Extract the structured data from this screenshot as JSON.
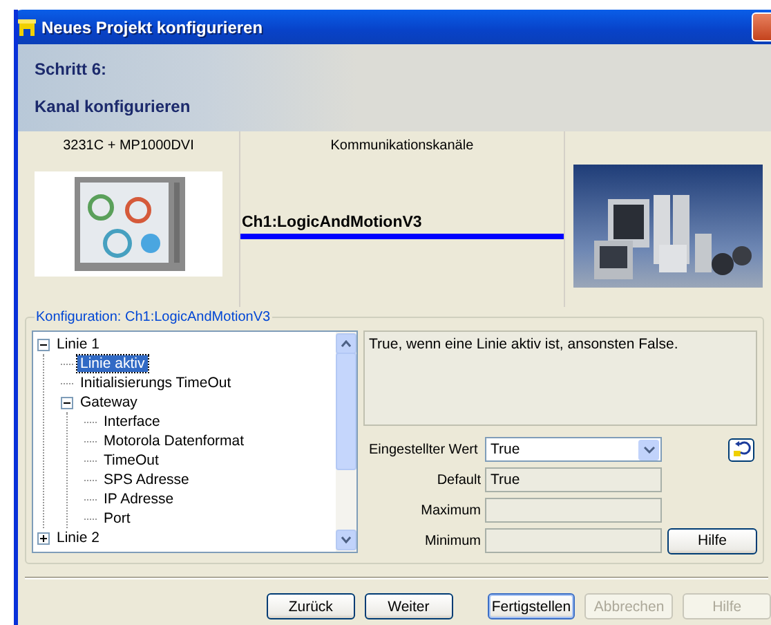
{
  "window": {
    "title": "Neues Projekt konfigurieren"
  },
  "header": {
    "step": "Schritt 6:",
    "subtitle": "Kanal konfigurieren"
  },
  "devices": {
    "device_label": "3231C + MP1000DVI",
    "channels_label": "Kommunikationskanäle",
    "channel": "Ch1:LogicAndMotionV3"
  },
  "config": {
    "legend": "Konfiguration: Ch1:LogicAndMotionV3",
    "tree": [
      {
        "label": "Linie 1",
        "expanded": true,
        "selected": false,
        "children": [
          {
            "label": "Linie aktiv",
            "selected": true
          },
          {
            "label": "Initialisierungs TimeOut",
            "selected": false
          },
          {
            "label": "Gateway",
            "expanded": true,
            "selected": false,
            "children": [
              {
                "label": "Interface",
                "selected": false
              },
              {
                "label": "Motorola Datenformat",
                "selected": false
              },
              {
                "label": "TimeOut",
                "selected": false
              },
              {
                "label": "SPS Adresse",
                "selected": false
              },
              {
                "label": "IP Adresse",
                "selected": false
              },
              {
                "label": "Port",
                "selected": false
              }
            ]
          }
        ]
      },
      {
        "label": "Linie 2",
        "expanded": false,
        "selected": false
      }
    ],
    "description": "True, wenn eine Linie aktiv ist, ansonsten False.",
    "fields": [
      {
        "kind": "combo",
        "label": "Eingestellter Wert",
        "value": "True"
      },
      {
        "kind": "readonly",
        "label": "Default",
        "value": "True"
      },
      {
        "kind": "readonly",
        "label": "Maximum"
      },
      {
        "kind": "readonly",
        "label": "Minimum"
      }
    ],
    "help_button": "Hilfe"
  },
  "buttons": [
    {
      "label": "Zurück",
      "disabled": false,
      "default": false
    },
    {
      "label": "Weiter",
      "disabled": false,
      "default": false
    },
    {
      "label": "Fertigstellen",
      "disabled": false,
      "default": true
    },
    {
      "label": "Abbrechen",
      "disabled": true,
      "default": false
    },
    {
      "label": "Hilfe",
      "disabled": true,
      "default": false
    }
  ]
}
